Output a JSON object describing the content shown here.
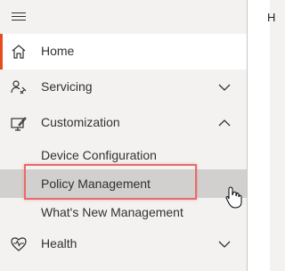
{
  "right_pane": {
    "peek_text": "H"
  },
  "nav": {
    "home": {
      "label": "Home",
      "icon": "home-icon"
    },
    "servicing": {
      "label": "Servicing",
      "icon": "servicing-icon"
    },
    "customization": {
      "label": "Customization",
      "icon": "customization-icon",
      "expanded": true,
      "children": [
        {
          "label": "Device Configuration"
        },
        {
          "label": "Policy Management"
        },
        {
          "label": "What's New Management"
        }
      ]
    },
    "health": {
      "label": "Health",
      "icon": "health-icon"
    }
  },
  "colors": {
    "accent": "#e74c1f",
    "highlight": "#e86a6a",
    "selected_bg": "#d2d0ce"
  }
}
